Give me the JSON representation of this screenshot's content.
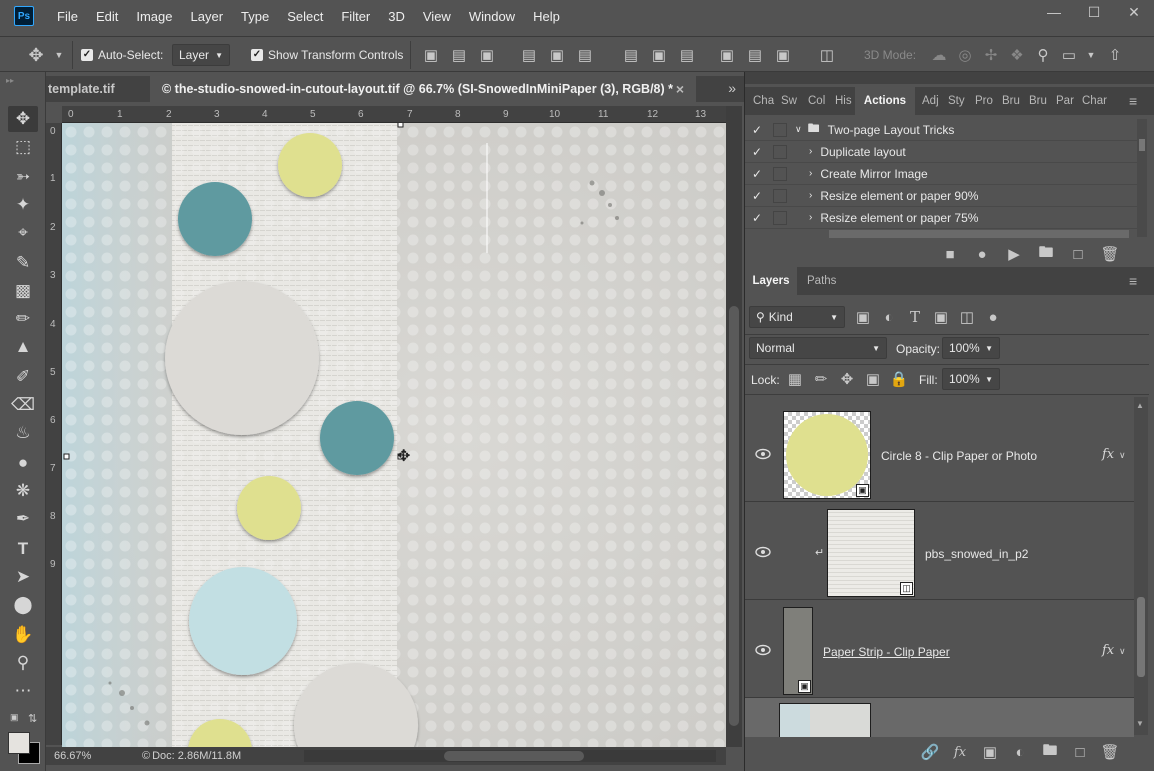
{
  "menu": {
    "logo": "Ps",
    "items": [
      "File",
      "Edit",
      "Image",
      "Layer",
      "Type",
      "Select",
      "Filter",
      "3D",
      "View",
      "Window",
      "Help"
    ]
  },
  "options": {
    "auto_select_label": "Auto-Select:",
    "auto_select_value": "Layer",
    "show_transform_label": "Show Transform Controls",
    "mode_3d_label": "3D Mode:"
  },
  "tabs": {
    "inactive": "template.tif",
    "active": "© the-studio-snowed-in-cutout-layout.tif @ 66.7% (SI-SnowedInMiniPaper (3), RGB/8) *",
    "close": "×",
    "overflow": "»"
  },
  "rulers": {
    "top": [
      "0",
      "1",
      "2",
      "3",
      "4",
      "5",
      "6",
      "7",
      "8",
      "9",
      "10",
      "11",
      "12",
      "13"
    ],
    "left": [
      "0",
      "1",
      "2",
      "3",
      "4",
      "5",
      "6",
      "7",
      "8",
      "9"
    ]
  },
  "status": {
    "zoom": "66.67%",
    "doc": "Doc: 2.86M/11.8M"
  },
  "actions_panel": {
    "tabs": [
      "Cha",
      "Sw",
      "Col",
      "His",
      "Actions",
      "Adj",
      "Sty",
      "Pro",
      "Bru",
      "Bru",
      "Par",
      "Char"
    ],
    "active_tab": "Actions",
    "rows": [
      {
        "label": "Two-page Layout Tricks",
        "type": "set",
        "checked": true
      },
      {
        "label": "Duplicate layout",
        "type": "action",
        "checked": true
      },
      {
        "label": "Create Mirror Image",
        "type": "action",
        "checked": true
      },
      {
        "label": "Resize element or paper 90%",
        "type": "action",
        "checked": true
      },
      {
        "label": "Resize element or paper 75%",
        "type": "action",
        "checked": true
      }
    ]
  },
  "layers_panel": {
    "tabs": [
      "Layers",
      "Paths"
    ],
    "filter_kind": "Kind",
    "blend_mode": "Normal",
    "opacity_label": "Opacity:",
    "opacity_value": "100%",
    "lock_label": "Lock:",
    "fill_label": "Fill:",
    "fill_value": "100%",
    "layers": [
      {
        "name": "Circle 8 - Clip Paper or Photo",
        "fx": "fx",
        "visible": true,
        "thumb_color": "#dfe08f"
      },
      {
        "name": "pbs_snowed_in_p2",
        "fx": "",
        "visible": true,
        "clipped": true
      },
      {
        "name": "Paper Strip - Clip Paper",
        "fx": "fx",
        "visible": true,
        "thumb_color": "#7f7f7a"
      }
    ]
  },
  "colors": {
    "app_bg": "#535353",
    "panel_dark": "#424242",
    "accent_blue": "#31a8ff",
    "teal_circle": "#5e9aa0",
    "yellow_circle": "#dfe08f",
    "light_blue_circle": "#c2dfe3",
    "gray_circle": "#dcdad6"
  }
}
